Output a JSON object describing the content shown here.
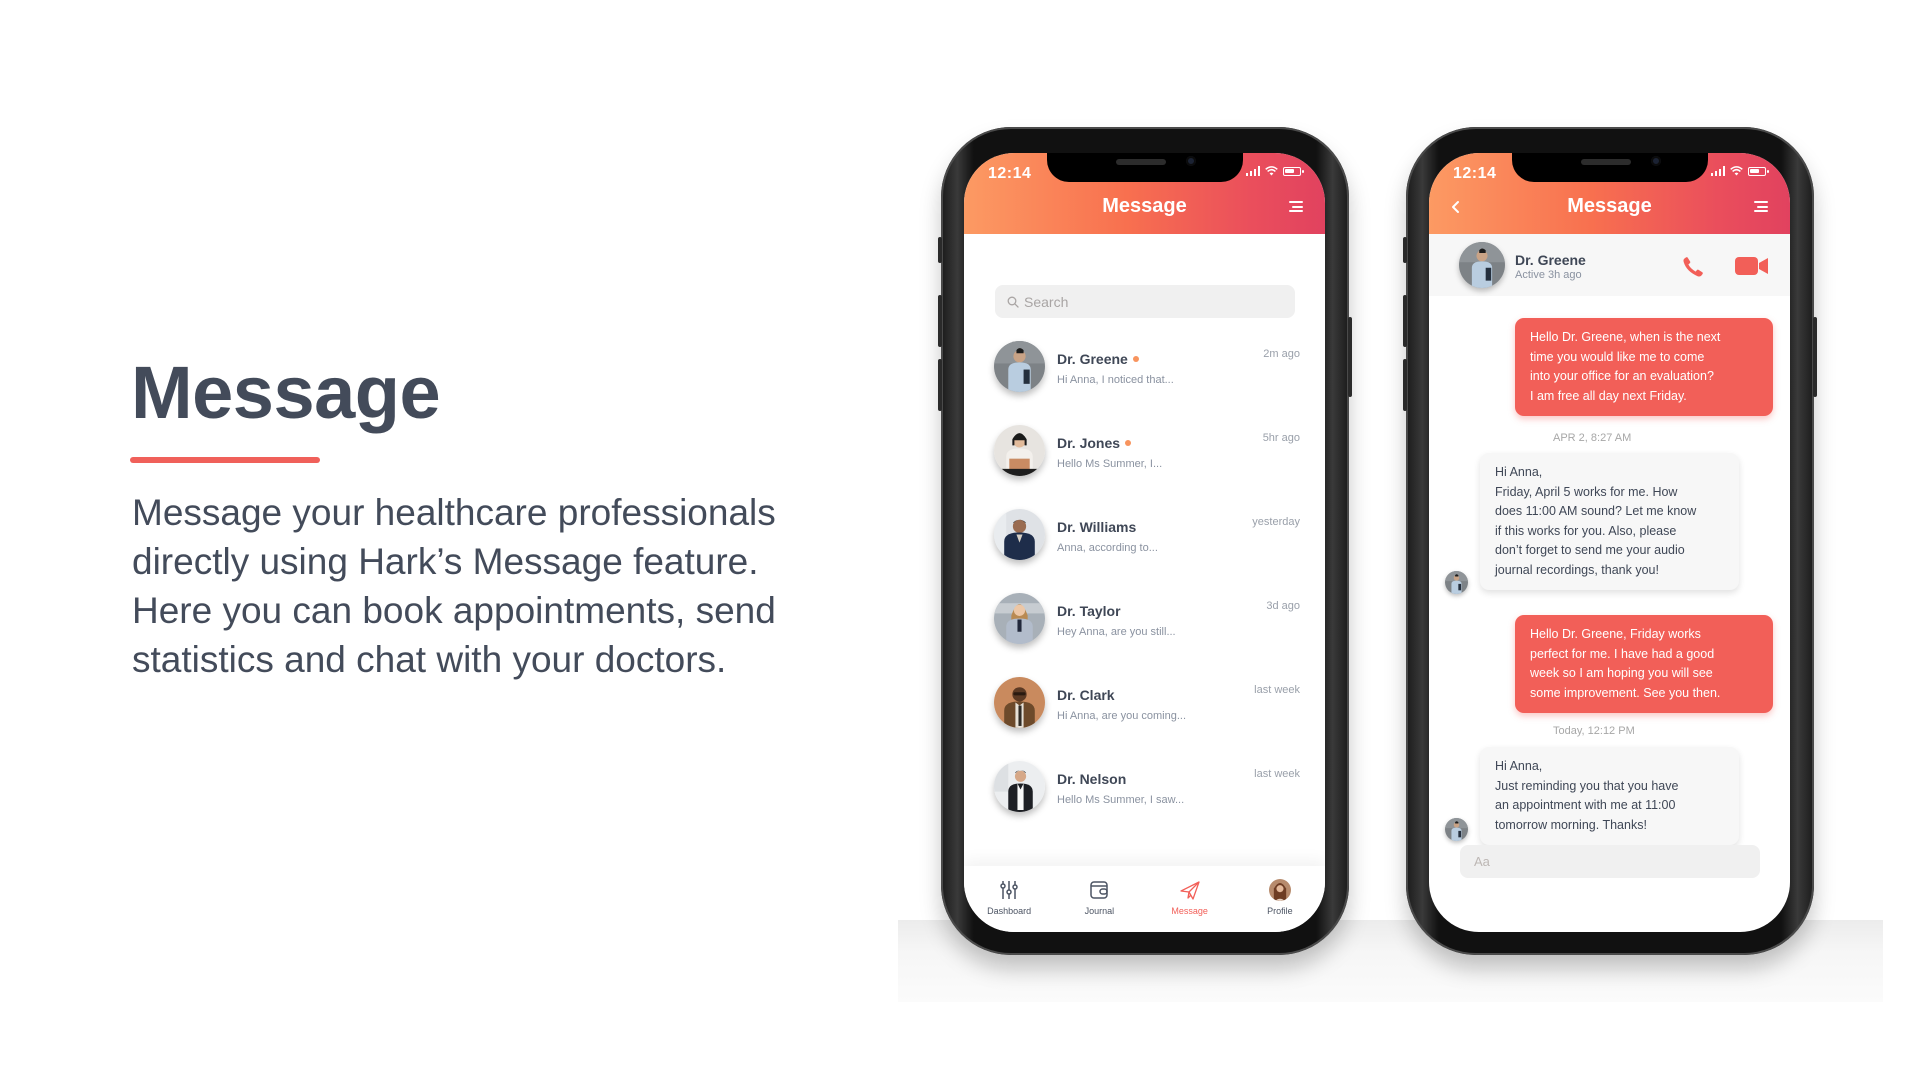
{
  "hero": {
    "title": "Message",
    "body_lines": [
      "Message your healthcare professionals",
      "directly using Hark’s Message feature.",
      "Here you can book appointments, send",
      "statistics and chat with your doctors."
    ],
    "accent_color": "#f0605a"
  },
  "status_bar": {
    "time": "12:14"
  },
  "list_screen": {
    "header_title": "Message",
    "search_placeholder": "Search",
    "contacts": [
      {
        "name": "Dr. Greene",
        "preview": "Hi Anna, I noticed that...",
        "time": "2m ago",
        "unread": true
      },
      {
        "name": "Dr. Jones",
        "preview": "Hello Ms Summer, I...",
        "time": "5hr ago",
        "unread": true
      },
      {
        "name": "Dr. Williams",
        "preview": "Anna, according to...",
        "time": "yesterday",
        "unread": false
      },
      {
        "name": "Dr. Taylor",
        "preview": "Hey Anna, are you still...",
        "time": "3d ago",
        "unread": false
      },
      {
        "name": "Dr. Clark",
        "preview": "Hi Anna, are you coming...",
        "time": "last week",
        "unread": false
      },
      {
        "name": "Dr. Nelson",
        "preview": "Hello Ms Summer, I saw...",
        "time": "last week",
        "unread": false
      }
    ],
    "tabs": [
      {
        "label": "Dashboard",
        "icon": "sliders-icon",
        "active": false
      },
      {
        "label": "Journal",
        "icon": "wallet-icon",
        "active": false
      },
      {
        "label": "Message",
        "icon": "paper-plane-icon",
        "active": true
      },
      {
        "label": "Profile",
        "icon": "profile-avatar",
        "active": false
      }
    ]
  },
  "chat_screen": {
    "header_title": "Message",
    "contact_name": "Dr. Greene",
    "contact_status": "Active 3h ago",
    "messages": [
      {
        "direction": "outgoing",
        "lines": [
          "Hello Dr. Greene, when is the next",
          "time you would like me to come",
          "into your office for an evaluation?",
          "I am free all day next Friday."
        ]
      },
      {
        "direction": "timestamp",
        "text": "APR 2, 8:27 AM"
      },
      {
        "direction": "incoming",
        "lines": [
          "Hi Anna,",
          "Friday, April 5 works for me. How",
          "does 11:00 AM sound? Let me know",
          "if this works for you. Also, please",
          "don’t forget to send me your audio",
          "journal recordings, thank you!"
        ]
      },
      {
        "direction": "outgoing",
        "lines": [
          "Hello Dr. Greene, Friday works",
          "perfect for me. I have had a good",
          "week so I am hoping you will see",
          "some improvement. See you then."
        ]
      },
      {
        "direction": "timestamp",
        "text": "Today, 12:12 PM"
      },
      {
        "direction": "incoming",
        "lines": [
          "Hi Anna,",
          "Just reminding you that you have",
          "an appointment with me at 11:00",
          "tomorrow morning. Thanks!"
        ]
      }
    ],
    "compose_placeholder": "Aa"
  },
  "colors": {
    "brand_gradient_start": "#fc9a63",
    "brand_gradient_end": "#e1425f",
    "bubble_outgoing": "#f25f58",
    "bubble_incoming": "#f7f7f7",
    "unread_dot": "#f8945e",
    "text_dark": "#434b5a"
  }
}
